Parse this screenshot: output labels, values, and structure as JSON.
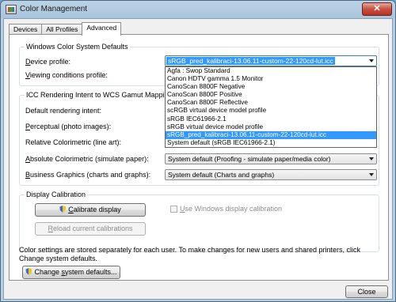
{
  "window": {
    "title": "Color Management",
    "close_glyph": "✕"
  },
  "tabs": [
    {
      "label": "Devices",
      "active": false
    },
    {
      "label": "All Profiles",
      "active": false
    },
    {
      "label": "Advanced",
      "active": true
    }
  ],
  "windows_defaults": {
    "group_title": "Windows Color System Defaults",
    "device_profile_label_u": "D",
    "device_profile_label_rest": "evice profile:",
    "device_profile_value": "sRGB_pred_kalibraci-13.06.11-custom-22-120cd-lut.icc",
    "viewing_label_u": "V",
    "viewing_label_rest": "iewing conditions profile:"
  },
  "dropdown_options": [
    "Agfa : Swop Standard",
    "Canon HDTV gamma 1.5 Monitor",
    "CanoScan 8800F Negative",
    "CanoScan 8800F Positive",
    "CanoScan 8800F Reflective",
    "scRGB virtual device model profile",
    "sRGB IEC61966-2.1",
    "sRGB virtual device model profile",
    "sRGB_pred_kalibraci-13.06.11-custom-22-120cd-lut.icc",
    "System default (sRGB IEC61966-2.1)"
  ],
  "icc_mapping": {
    "group_title": "ICC Rendering Intent to WCS Gamut Mapping",
    "default_intent_label": "Default rendering intent:",
    "perceptual_label_u": "P",
    "perceptual_label_rest": "erceptual (photo images):",
    "relative_label": "Relative Colorimetric (line art):",
    "absolute_label_u": "A",
    "absolute_label_rest": "bsolute Colorimetric (simulate paper):",
    "absolute_value": "System default (Proofing - simulate paper/media color)",
    "business_label_u": "B",
    "business_label_rest": "usiness Graphics (charts and graphs):",
    "business_value": "System default (Charts and graphs)"
  },
  "display_calibration": {
    "group_title": "Display Calibration",
    "calibrate_button_u": "C",
    "calibrate_button_rest": "alibrate display",
    "use_windows_u": "U",
    "use_windows_rest": "se Windows display calibration",
    "reload_button_u": "R",
    "reload_button_rest": "eload current calibrations"
  },
  "footer": {
    "note": "Color settings are stored separately for each user. To make changes for new users and shared printers, click Change system defaults.",
    "change_defaults_u": "Change ",
    "change_defaults_s": "s",
    "change_defaults_rest": "ystem defaults...",
    "close_button": "Close"
  }
}
